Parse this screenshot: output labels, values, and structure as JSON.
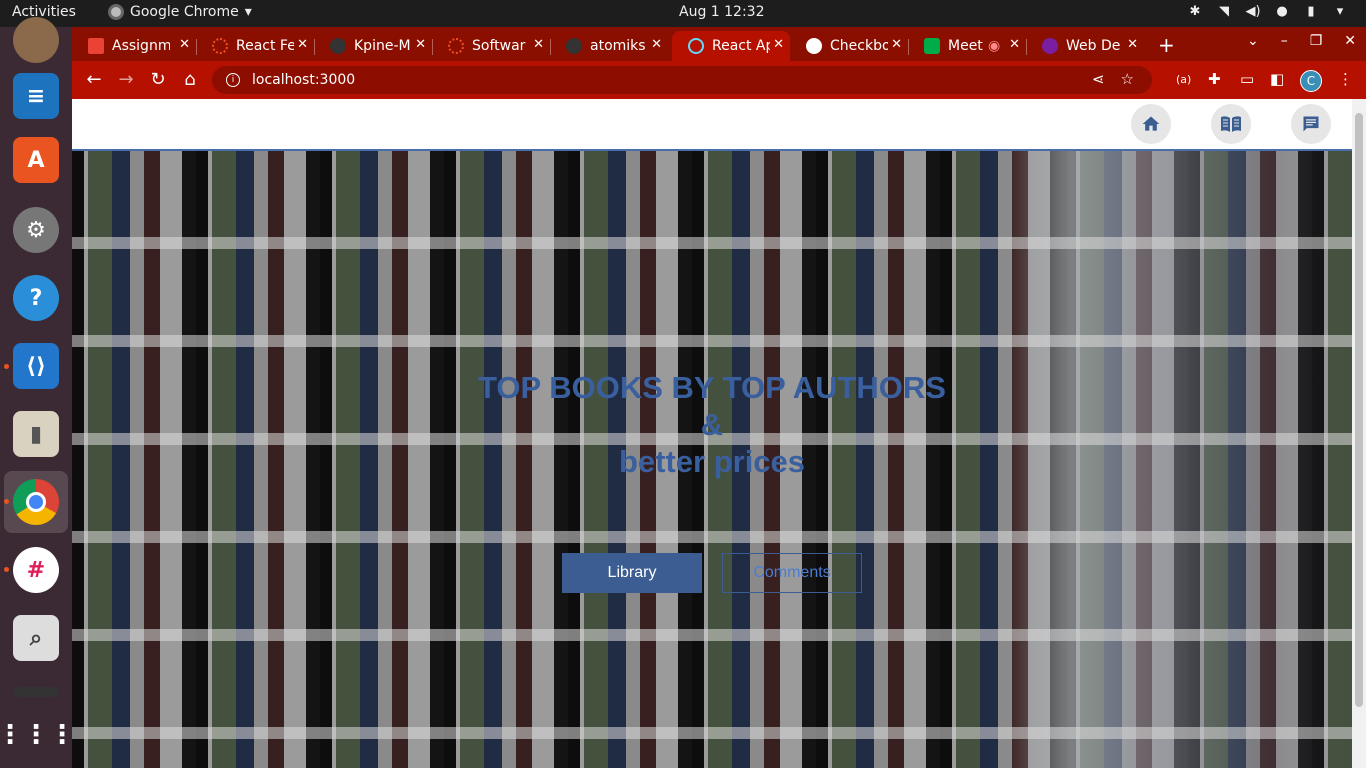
{
  "topbar": {
    "activities": "Activities",
    "app_name": "Google Chrome",
    "clock": "Aug 1  12:32"
  },
  "dock": {
    "apps": [
      "speaker-icon",
      "writer-icon",
      "app-center-icon",
      "settings-icon",
      "help-icon",
      "vscode-icon",
      "archive-icon",
      "chrome-icon",
      "slack-icon",
      "search-tool-icon",
      "terminal-icon",
      "show-apps-icon"
    ]
  },
  "tabs": [
    {
      "label": "Assignm",
      "color": "#ea4335"
    },
    {
      "label": "React Fe",
      "color": "#f25022"
    },
    {
      "label": "Kpine-M",
      "color": "#333333"
    },
    {
      "label": "Softwar",
      "color": "#f25022"
    },
    {
      "label": "atomiks",
      "color": "#333333"
    },
    {
      "label": "React Ap",
      "color": "#61dafb"
    },
    {
      "label": "Checkbo",
      "color": "#ffffff"
    },
    {
      "label": "Meet",
      "color": "#00ac47"
    },
    {
      "label": "Web De",
      "color": "#7b1fa2"
    }
  ],
  "address_bar": {
    "url": "localhost:3000"
  },
  "profile": {
    "initial": "C"
  },
  "hero": {
    "line1": "TOP BOOKS BY TOP AUTHORS",
    "line2": "&",
    "line3": "better prices",
    "library_button": "Library",
    "comments_button": "Comments"
  },
  "colors": {
    "accent": "#3b5d91",
    "chrome_theme": "#b51000",
    "title_text": "#3a5f9e"
  }
}
